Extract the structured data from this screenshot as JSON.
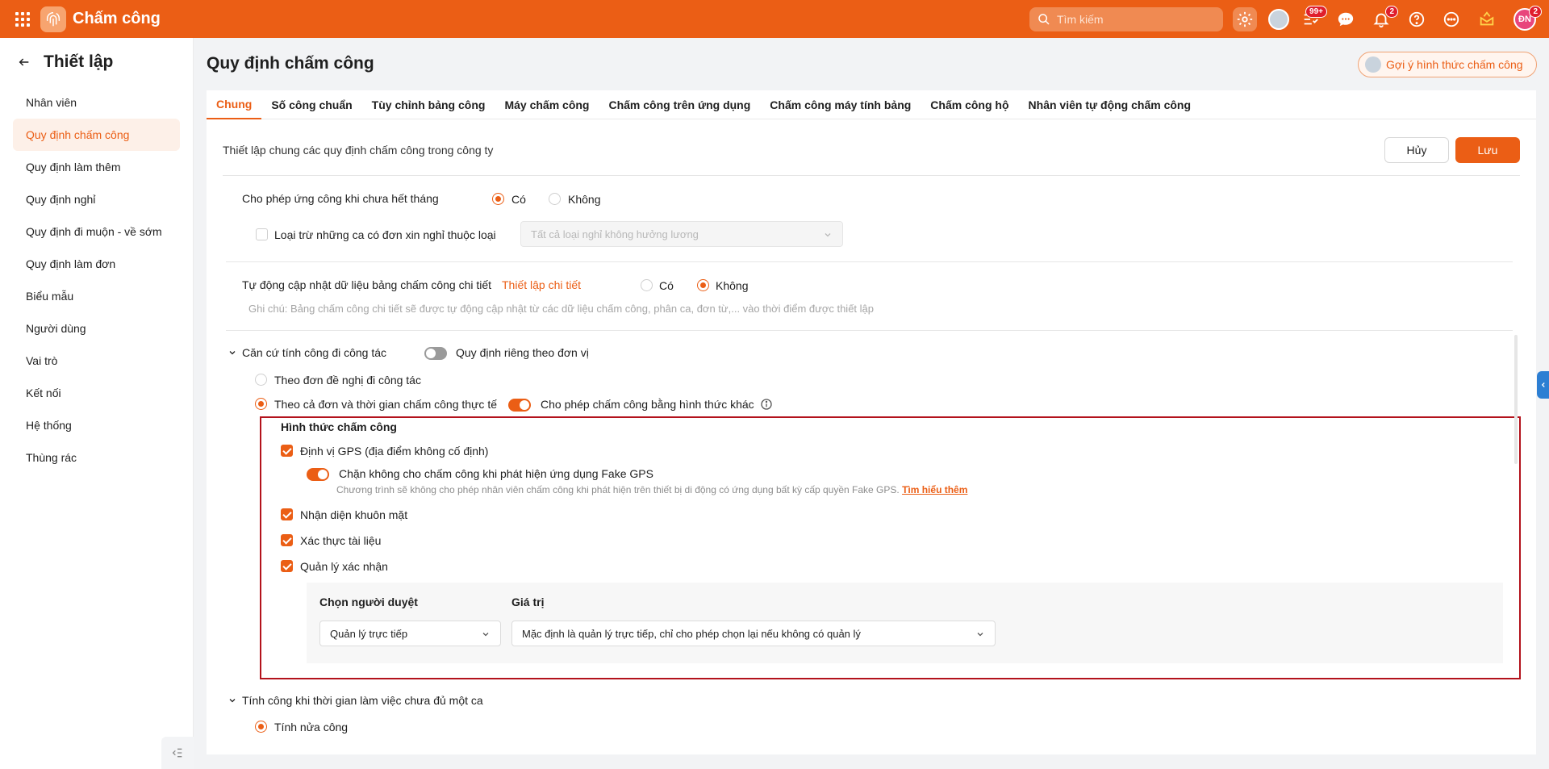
{
  "app": {
    "name": "Chấm công"
  },
  "topbar": {
    "search_placeholder": "Tìm kiếm",
    "badge_tasks": "99+",
    "badge_notifications": "2",
    "badge_user": "2",
    "user_initials": "ĐN"
  },
  "sidebar": {
    "title": "Thiết lập",
    "items": [
      {
        "label": "Nhân viên"
      },
      {
        "label": "Quy định chấm công"
      },
      {
        "label": "Quy định làm thêm"
      },
      {
        "label": "Quy định nghỉ"
      },
      {
        "label": "Quy định đi muộn - về sớm"
      },
      {
        "label": "Quy định làm đơn"
      },
      {
        "label": "Biểu mẫu"
      },
      {
        "label": "Người dùng"
      },
      {
        "label": "Vai trò"
      },
      {
        "label": "Kết nối"
      },
      {
        "label": "Hệ thống"
      },
      {
        "label": "Thùng rác"
      }
    ]
  },
  "page": {
    "title": "Quy định chấm công",
    "suggest_button": "Gợi ý hình thức chấm công"
  },
  "tabs": [
    {
      "label": "Chung"
    },
    {
      "label": "Số công chuẩn"
    },
    {
      "label": "Tùy chỉnh bảng công"
    },
    {
      "label": "Máy chấm công"
    },
    {
      "label": "Chấm công trên ứng dụng"
    },
    {
      "label": "Chấm công máy tính bảng"
    },
    {
      "label": "Chấm công hộ"
    },
    {
      "label": "Nhân viên tự động chấm công"
    }
  ],
  "content": {
    "intro": "Thiết lập chung các quy định chấm công trong công ty",
    "cancel_label": "Hủy",
    "save_label": "Lưu",
    "advance": {
      "label": "Cho phép ứng công khi chưa hết tháng",
      "yes": "Có",
      "no": "Không",
      "exclude_label": "Loại trừ những ca có đơn xin nghỉ thuộc loại",
      "exclude_select": "Tất cả loại nghỉ không hưởng lương"
    },
    "auto_update": {
      "label": "Tự động cập nhật dữ liệu bảng chấm công chi tiết",
      "link": "Thiết lập chi tiết",
      "yes": "Có",
      "no": "Không",
      "note": "Ghi chú: Bảng chấm công chi tiết sẽ được tự động cập nhật từ các dữ liệu chấm công, phân ca, đơn từ,... vào thời điểm được thiết lập"
    },
    "business_trip": {
      "label": "Căn cứ tính công đi công tác",
      "unit_toggle": "Quy định riêng theo đơn vị",
      "option1": "Theo đơn đề nghị đi công tác",
      "option2": "Theo cả đơn và thời gian chấm công thực tế",
      "allow_other": "Cho phép chấm công bằng hình thức khác"
    },
    "methods": {
      "title": "Hình thức chấm công",
      "gps": "Định vị GPS (địa điểm không cố định)",
      "fake_gps": "Chặn không cho chấm công khi phát hiện ứng dụng Fake GPS",
      "fake_gps_desc": "Chương trình sẽ không cho phép nhân viên chấm công khi phát hiện trên thiết bị di động có ứng dụng bất kỳ cấp quyền Fake GPS.",
      "learn_more": "Tìm hiểu thêm",
      "face": "Nhận diện khuôn mặt",
      "document": "Xác thực tài liệu",
      "manager": "Quản lý xác nhận",
      "approver_header": "Chọn người duyệt",
      "value_header": "Giá trị",
      "approver_value": "Quản lý trực tiếp",
      "value_value": "Mặc định là quản lý trực tiếp, chỉ cho phép chọn lại nếu không có quản lý"
    },
    "insufficient": {
      "label": "Tính công khi thời gian làm việc chưa đủ một ca",
      "option": "Tính nửa công"
    }
  },
  "colors": {
    "accent": "#eb5e15",
    "highlight_border": "#b3121c"
  }
}
